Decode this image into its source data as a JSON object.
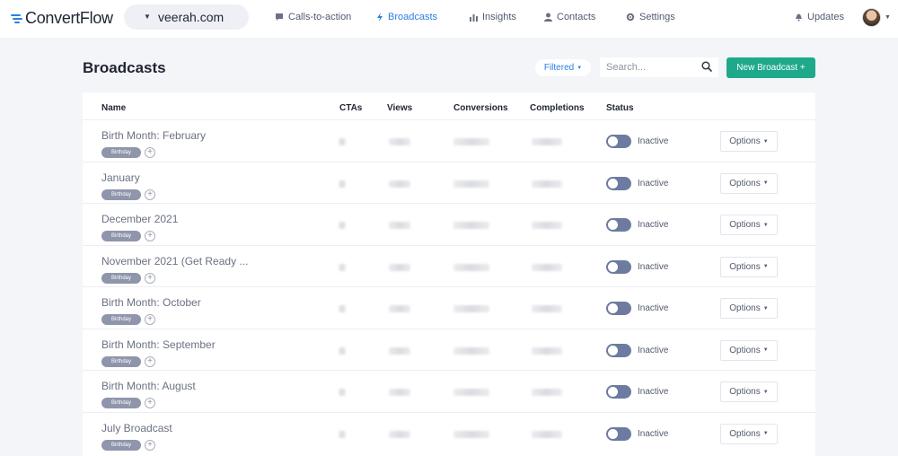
{
  "nav": {
    "logo": "ConvertFlow",
    "site": "veerah.com",
    "items": [
      {
        "label": "Calls-to-action",
        "icon": "chat-icon"
      },
      {
        "label": "Broadcasts",
        "icon": "lightning-icon"
      },
      {
        "label": "Insights",
        "icon": "bar-chart-icon"
      },
      {
        "label": "Contacts",
        "icon": "user-icon"
      },
      {
        "label": "Settings",
        "icon": "gear-icon"
      }
    ],
    "updates": "Updates",
    "active_color": "#2b7fe0"
  },
  "header": {
    "title": "Broadcasts",
    "filter": "Filtered",
    "search_placeholder": "Search...",
    "new_button": "New Broadcast +"
  },
  "table": {
    "columns": [
      "Name",
      "CTAs",
      "Views",
      "Conversions",
      "Completions",
      "Status"
    ],
    "rows": [
      {
        "name": "Birth Month: February",
        "tag": "Birthday",
        "status": "Inactive",
        "options": "Options"
      },
      {
        "name": "January",
        "tag": "Birthday",
        "status": "Inactive",
        "options": "Options"
      },
      {
        "name": "December 2021",
        "tag": "Birthday",
        "status": "Inactive",
        "options": "Options"
      },
      {
        "name": "November 2021 (Get Ready ...",
        "tag": "Birthday",
        "status": "Inactive",
        "options": "Options"
      },
      {
        "name": "Birth Month: October",
        "tag": "Birthday",
        "status": "Inactive",
        "options": "Options"
      },
      {
        "name": "Birth Month: September",
        "tag": "Birthday",
        "status": "Inactive",
        "options": "Options"
      },
      {
        "name": "Birth Month: August",
        "tag": "Birthday",
        "status": "Inactive",
        "options": "Options"
      },
      {
        "name": "July Broadcast",
        "tag": "Birthday",
        "status": "Inactive",
        "options": "Options"
      }
    ]
  },
  "colors": {
    "primary_button": "#1fa98b",
    "toggle_off": "#6c7b9f",
    "tag": "#8f95ab"
  }
}
